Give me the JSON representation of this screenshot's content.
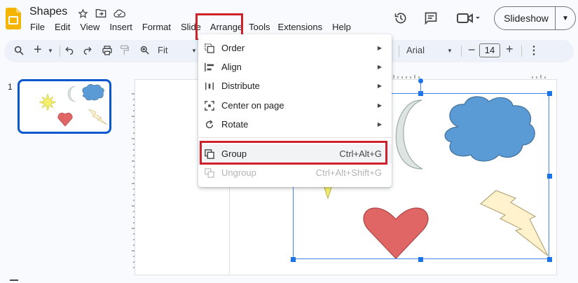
{
  "app": {
    "title": "Shapes",
    "colors": {
      "brand": "#f4b400",
      "accent": "#0b57d0",
      "highlight": "#d0222a"
    }
  },
  "menubar": {
    "items": [
      "File",
      "Edit",
      "View",
      "Insert",
      "Format",
      "Slide",
      "Arrange",
      "Tools",
      "Extensions",
      "Help"
    ]
  },
  "header": {
    "slideshow_label": "Slideshow",
    "icons": [
      "history-icon",
      "comment-icon",
      "meet-icon"
    ]
  },
  "toolbar": {
    "zoom_label": "Fit",
    "font_name": "Arial",
    "font_size": "14"
  },
  "filmstrip": {
    "slide_number": "1"
  },
  "arrange_menu": {
    "items": [
      {
        "label": "Order",
        "icon": "order-icon",
        "submenu": true
      },
      {
        "label": "Align",
        "icon": "align-icon",
        "submenu": true
      },
      {
        "label": "Distribute",
        "icon": "distribute-icon",
        "submenu": true
      },
      {
        "label": "Center on page",
        "icon": "center-icon",
        "submenu": true
      },
      {
        "label": "Rotate",
        "icon": "rotate-icon",
        "submenu": true
      },
      {
        "label": "Group",
        "icon": "group-icon",
        "shortcut": "Ctrl+Alt+G"
      },
      {
        "label": "Ungroup",
        "icon": "ungroup-icon",
        "shortcut": "Ctrl+Alt+Shift+G",
        "disabled": true
      }
    ]
  }
}
